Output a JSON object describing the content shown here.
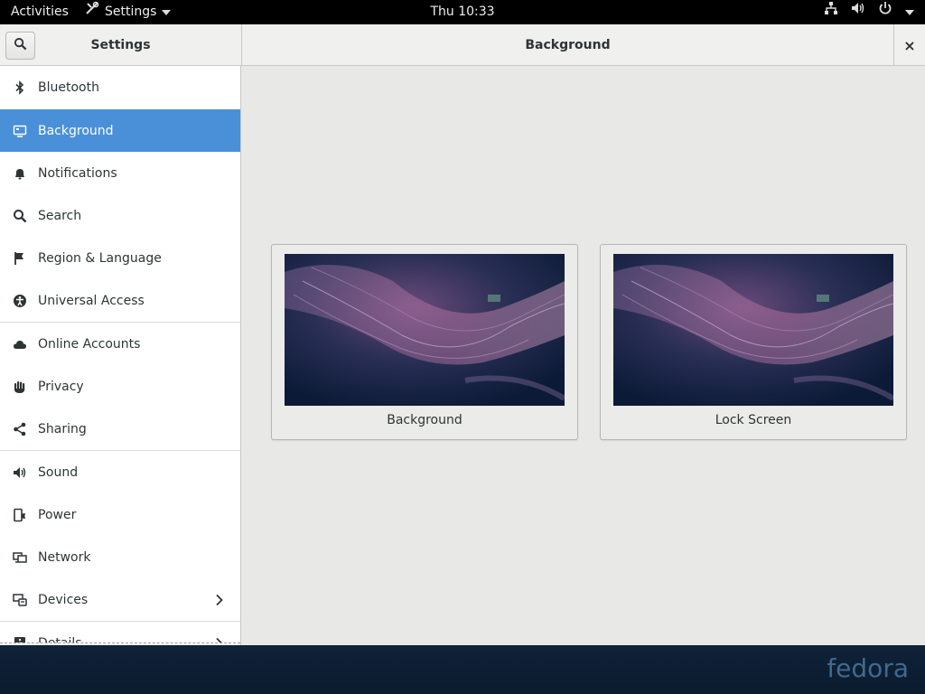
{
  "topbar": {
    "activities": "Activities",
    "app_menu": "Settings",
    "clock": "Thu 10:33",
    "tray_icons": [
      "network-wired-icon",
      "volume-icon",
      "power-icon",
      "chevron-down-icon"
    ]
  },
  "window": {
    "sidebar_title": "Settings",
    "page_title": "Background",
    "close_glyph": "×"
  },
  "sidebar": {
    "items": [
      {
        "label": "Bluetooth",
        "icon": "bluetooth-icon"
      },
      {
        "label": "Background",
        "icon": "background-icon",
        "selected": true
      },
      {
        "label": "Notifications",
        "icon": "bell-icon"
      },
      {
        "label": "Search",
        "icon": "search-icon"
      },
      {
        "label": "Region & Language",
        "icon": "flag-icon"
      },
      {
        "label": "Universal Access",
        "icon": "accessibility-icon"
      },
      {
        "label": "Online Accounts",
        "icon": "cloud-icon"
      },
      {
        "label": "Privacy",
        "icon": "hand-icon"
      },
      {
        "label": "Sharing",
        "icon": "share-icon"
      },
      {
        "label": "Sound",
        "icon": "speaker-icon"
      },
      {
        "label": "Power",
        "icon": "power-plug-icon"
      },
      {
        "label": "Network",
        "icon": "network-icon"
      },
      {
        "label": "Devices",
        "icon": "devices-icon",
        "has_submenu": true
      },
      {
        "label": "Details",
        "icon": "info-icon",
        "has_submenu": true
      }
    ]
  },
  "content": {
    "cards": [
      {
        "caption": "Background"
      },
      {
        "caption": "Lock Screen"
      }
    ]
  },
  "desktop": {
    "logo_text": "fedora"
  },
  "colors": {
    "accent": "#4a90d9",
    "topbar": "#000000",
    "content_bg": "#e8e8e7"
  }
}
